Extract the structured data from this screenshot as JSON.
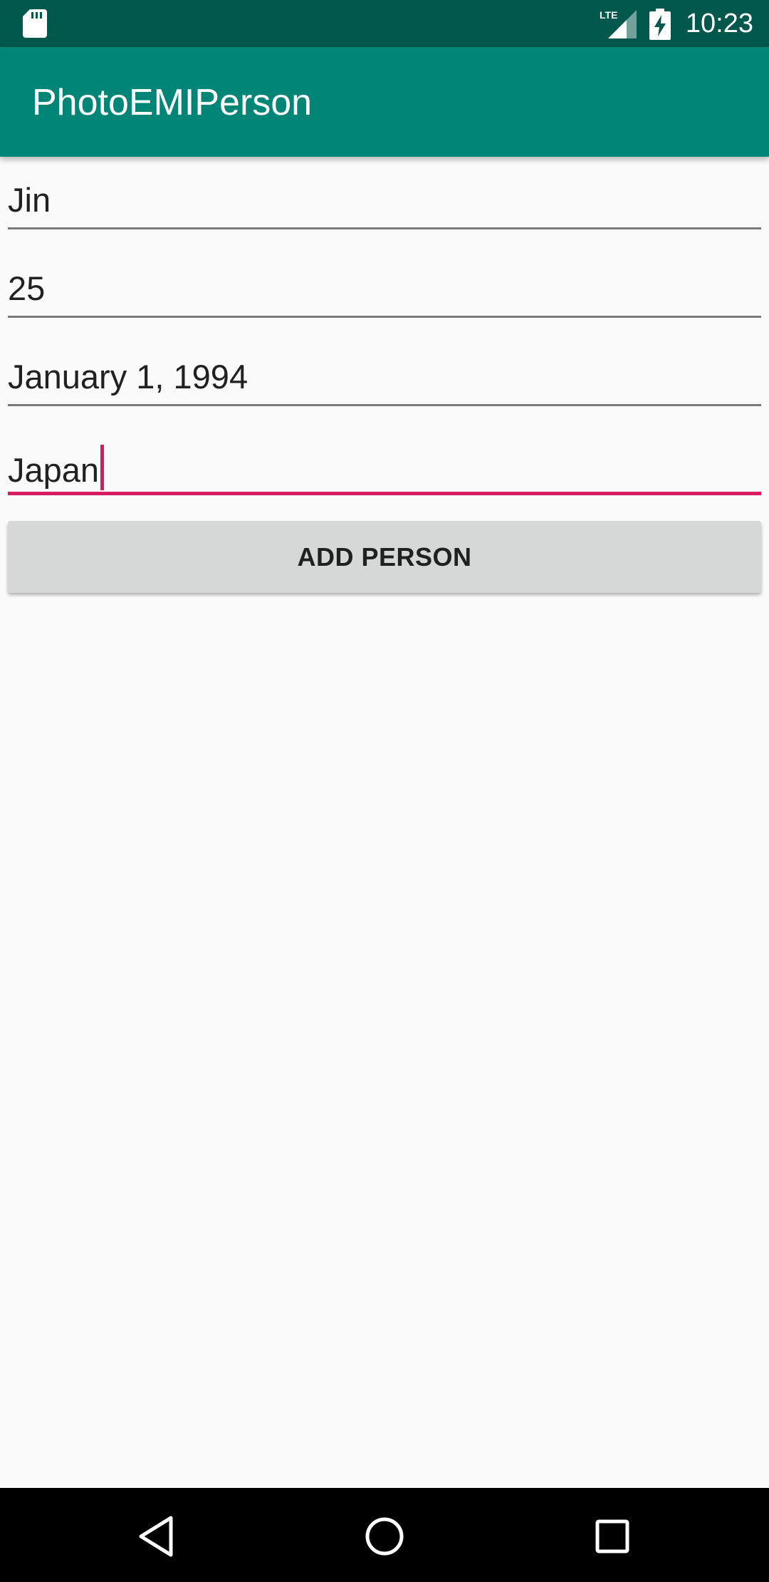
{
  "status_bar": {
    "time": "10:23",
    "network": "LTE",
    "icons": [
      "sd-card-icon",
      "lte-signal-icon",
      "battery-charging-icon"
    ]
  },
  "app_bar": {
    "title": "PhotoEMIPerson"
  },
  "form": {
    "name_value": "Jin",
    "age_value": "25",
    "birthdate_value": "January 1, 1994",
    "country_value": "Japan",
    "add_button_label": "ADD PERSON"
  },
  "nav_bar": {
    "icons": [
      "back-icon",
      "home-icon",
      "recents-icon"
    ]
  },
  "colors": {
    "status_bar": "#00574b",
    "app_bar": "#008577",
    "accent": "#d81b60",
    "background": "#fafafa",
    "button": "#d6d7d7"
  }
}
